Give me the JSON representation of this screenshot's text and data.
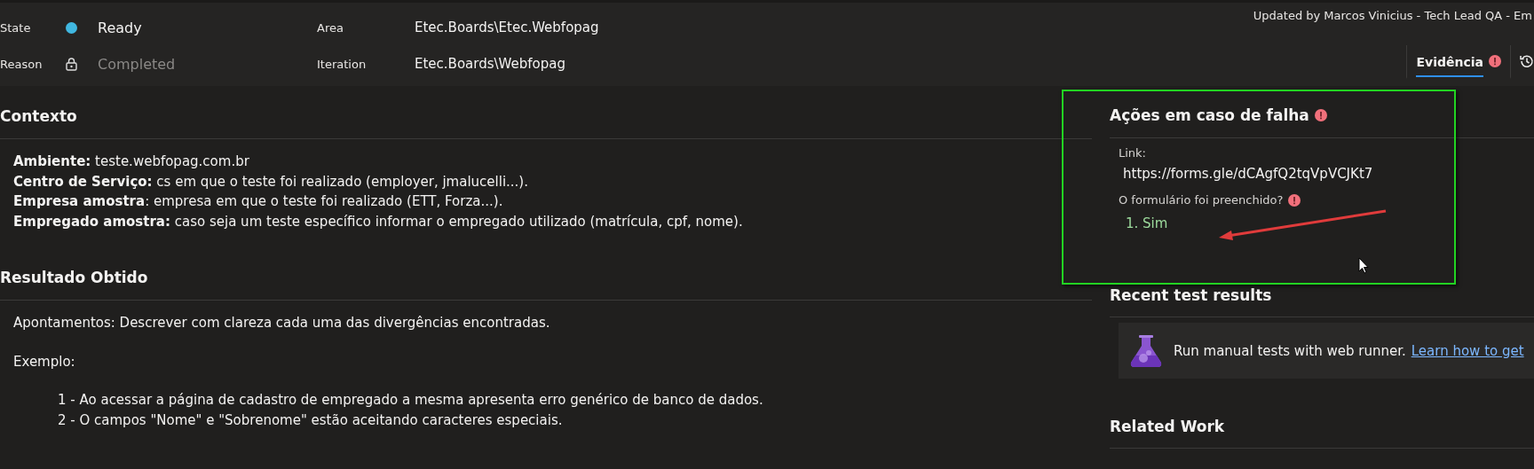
{
  "header": {
    "fields": [
      {
        "label": "State",
        "value": "Ready",
        "kind": "state",
        "color": "#40b7e0"
      },
      {
        "label": "Reason",
        "value": "Completed",
        "kind": "locked"
      },
      {
        "label": "Area",
        "value": "Etec.Boards\\Etec.Webfopag",
        "kind": "plain"
      },
      {
        "label": "Iteration",
        "value": "Etec.Boards\\Webfopag",
        "kind": "plain"
      }
    ],
    "updated_by": "Updated by Marcos Vinicius - Tech Lead QA - Em",
    "tabs": [
      {
        "kind": "text",
        "label": "Evidência",
        "selected": true,
        "error": true
      },
      {
        "kind": "history",
        "selected": false
      }
    ]
  },
  "sections": [
    {
      "title": "Contexto",
      "paragraphs": [
        {
          "kind": "line",
          "text": "**Ambiente:** teste.webfopag.com.br"
        },
        {
          "kind": "line",
          "text": "**Centro de Serviço:** cs em que o teste foi realizado (employer, jmalucelli...)."
        },
        {
          "kind": "line",
          "text": "**Empresa amostra**: empresa em que o teste foi realizado (ETT, Forza...)."
        },
        {
          "kind": "line",
          "text": "**Empregado amostra:** caso seja um teste específico informar o empregado utilizado (matrícula, cpf, nome)."
        }
      ]
    },
    {
      "title": "Resultado Obtido",
      "paragraphs": [
        {
          "kind": "para",
          "text": "Apontamentos: Descrever com clareza cada uma das divergências encontradas."
        },
        {
          "kind": "para",
          "text": "Exemplo:"
        },
        {
          "kind": "indent",
          "text": "1 - Ao acessar a página de cadastro de empregado a mesma apresenta erro genérico de banco de dados."
        },
        {
          "kind": "indent",
          "text": "2 - O campos \"Nome\" e \"Sobrenome\" estão aceitando caracteres especiais."
        }
      ]
    }
  ],
  "actions": {
    "title": "Ações em caso de falha",
    "error": true,
    "link_label": "Link:",
    "link": "https://forms.gle/dCAgfQ2tqVpVCJKt7",
    "question": "O formulário foi preenchido?",
    "question_error": true,
    "answer": "1. Sim"
  },
  "recent_tests": {
    "title": "Recent test results",
    "message": "Run manual tests with web runner.",
    "link": "Learn how to get"
  },
  "related_work": {
    "title": "Related Work"
  }
}
